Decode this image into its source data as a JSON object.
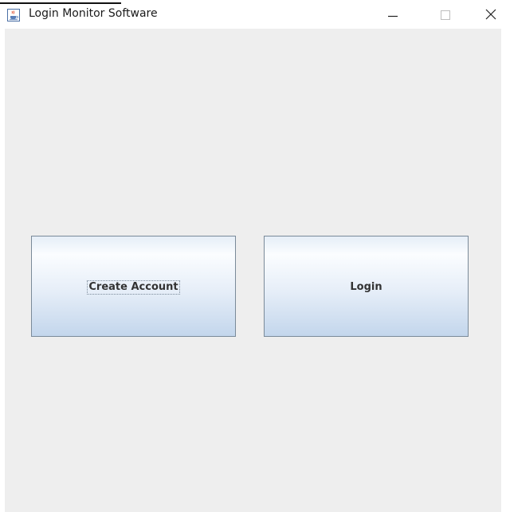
{
  "window": {
    "title": "Login Monitor Software",
    "app_icon": "java-cup-icon",
    "controls": {
      "minimize_icon": "minimize-icon",
      "maximize_icon": "maximize-icon",
      "close_icon": "close-icon"
    }
  },
  "main": {
    "buttons": {
      "create_account": "Create Account",
      "login": "Login"
    },
    "focused_button": "create_account"
  },
  "colors": {
    "content_background": "#eeeeee",
    "button_gradient_top": "#fbfdff",
    "button_gradient_bottom": "#c3d6ec",
    "button_border": "#7a8a99"
  }
}
